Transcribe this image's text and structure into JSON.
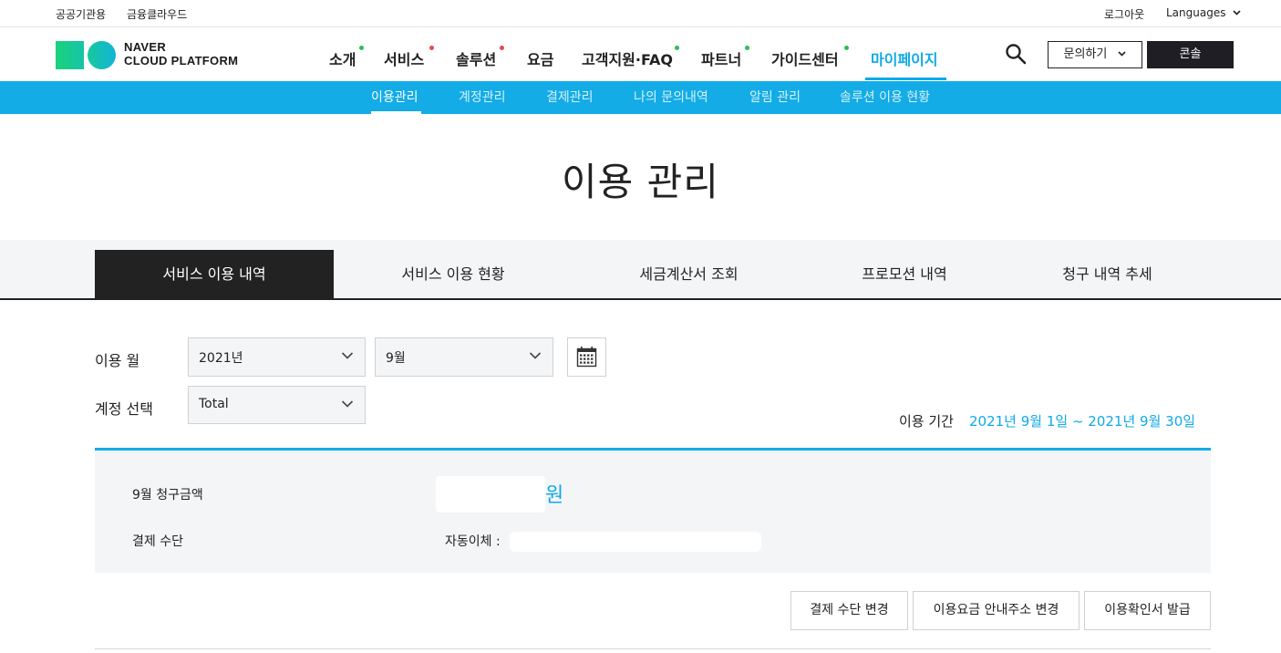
{
  "utility": {
    "left_links": [
      "공공기관용",
      "금융클라우드"
    ],
    "logout": "로그아웃",
    "languages": "Languages"
  },
  "brand": {
    "line1": "NAVER",
    "line2": "CLOUD PLATFORM"
  },
  "nav": {
    "items": [
      "소개",
      "서비스",
      "솔루션",
      "요금",
      "고객지원·FAQ",
      "파트너",
      "가이드센터",
      "마이페이지"
    ],
    "active": "마이페이지",
    "inquiry_label": "문의하기",
    "console_label": "콘솔"
  },
  "subnav": {
    "items": [
      "이용관리",
      "계정관리",
      "결제관리",
      "나의 문의내역",
      "알림 관리",
      "솔루션 이용 현황"
    ],
    "active": "이용관리"
  },
  "page_title": "이용 관리",
  "tabs": {
    "items": [
      "서비스 이용 내역",
      "서비스 이용 현황",
      "세금계산서 조회",
      "프로모션 내역",
      "청구 내역 추세"
    ],
    "active": "서비스 이용 내역"
  },
  "filters": {
    "month_label": "이용 월",
    "year_value": "2021년",
    "month_value": "9월",
    "account_label": "계정 선택",
    "account_value": "Total",
    "period_label": "이용 기간",
    "period_value": "2021년 9월 1일 ~ 2021년 9월 30일"
  },
  "summary": {
    "billing_label": "9월 청구금액",
    "currency": "원",
    "payment_label": "결제 수단",
    "payment_prefix": "자동이체 :"
  },
  "actions": {
    "change_payment": "결제 수단 변경",
    "change_address": "이용요금 안내주소 변경",
    "issue_certificate": "이용확인서 발급"
  },
  "colors": {
    "accent": "#13ace6",
    "dark": "#222222",
    "dot_green": "#2dbe4e",
    "dot_red": "#e5484d"
  }
}
